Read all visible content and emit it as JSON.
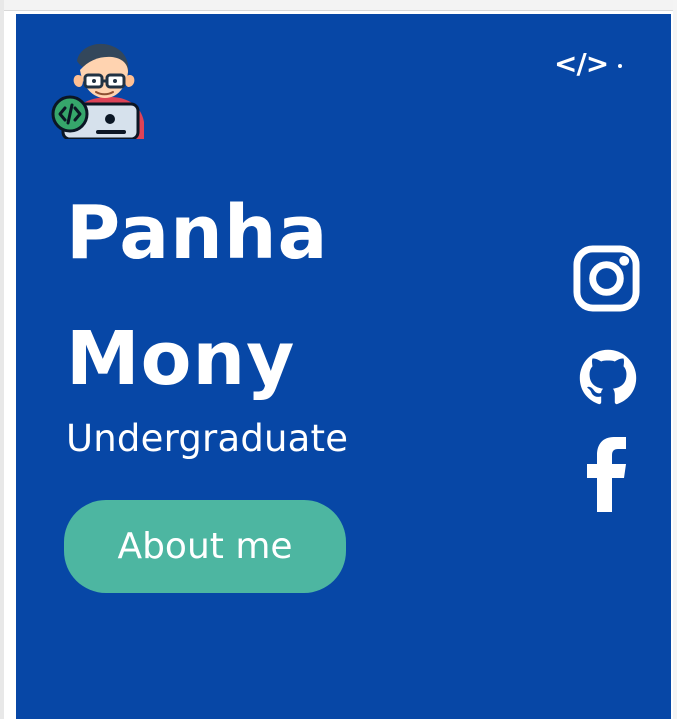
{
  "page": {
    "background": "#ffffff",
    "hero_background": "#0747a6",
    "accent_button": "#4db6a1",
    "text_color": "#ffffff"
  },
  "header": {
    "avatar_icon": "developer-avatar-icon",
    "code_mark_icon": "code-brackets-icon"
  },
  "hero": {
    "name_first": "Panha",
    "name_last": "Mony",
    "subtitle": "Undergraduate",
    "about_button_label": "About me"
  },
  "social": {
    "items": [
      {
        "name": "instagram",
        "icon": "instagram-icon"
      },
      {
        "name": "github",
        "icon": "github-icon"
      },
      {
        "name": "facebook",
        "icon": "facebook-icon"
      }
    ]
  }
}
